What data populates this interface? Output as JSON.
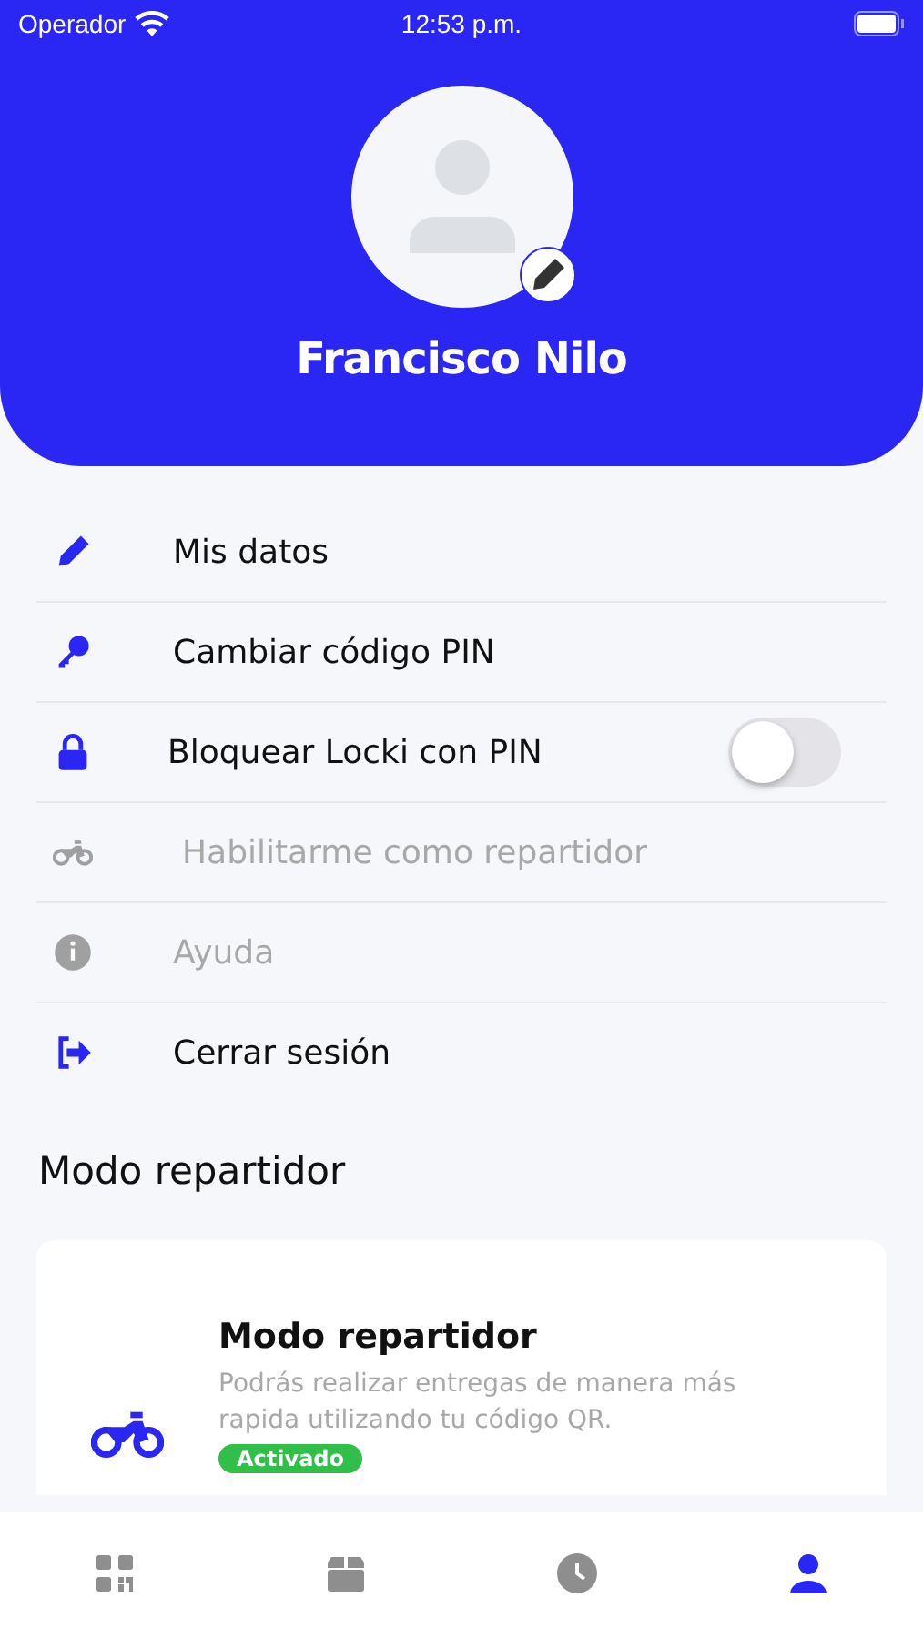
{
  "status_bar": {
    "carrier": "Operador",
    "time": "12:53 p.m."
  },
  "profile": {
    "name": "Francisco Nilo"
  },
  "menu": [
    {
      "kind": "link",
      "label": "Mis datos",
      "disabled": false
    },
    {
      "kind": "link",
      "label": "Cambiar código PIN",
      "disabled": false
    },
    {
      "kind": "toggle",
      "label": "Bloquear Locki con PIN",
      "disabled": false,
      "on": false
    },
    {
      "kind": "link",
      "label": "Habilitarme como repartidor",
      "disabled": true
    },
    {
      "kind": "link",
      "label": "Ayuda",
      "disabled": true
    },
    {
      "kind": "link",
      "label": "Cerrar sesión",
      "disabled": false
    }
  ],
  "section_title": "Modo repartidor",
  "card": {
    "title": "Modo repartidor",
    "description": "Podrás realizar entregas de manera más rapida utilizando tu código QR.",
    "badge": "Activado"
  },
  "tab_bar": [
    {
      "selected": false
    },
    {
      "selected": false
    },
    {
      "selected": false
    },
    {
      "selected": true
    }
  ]
}
